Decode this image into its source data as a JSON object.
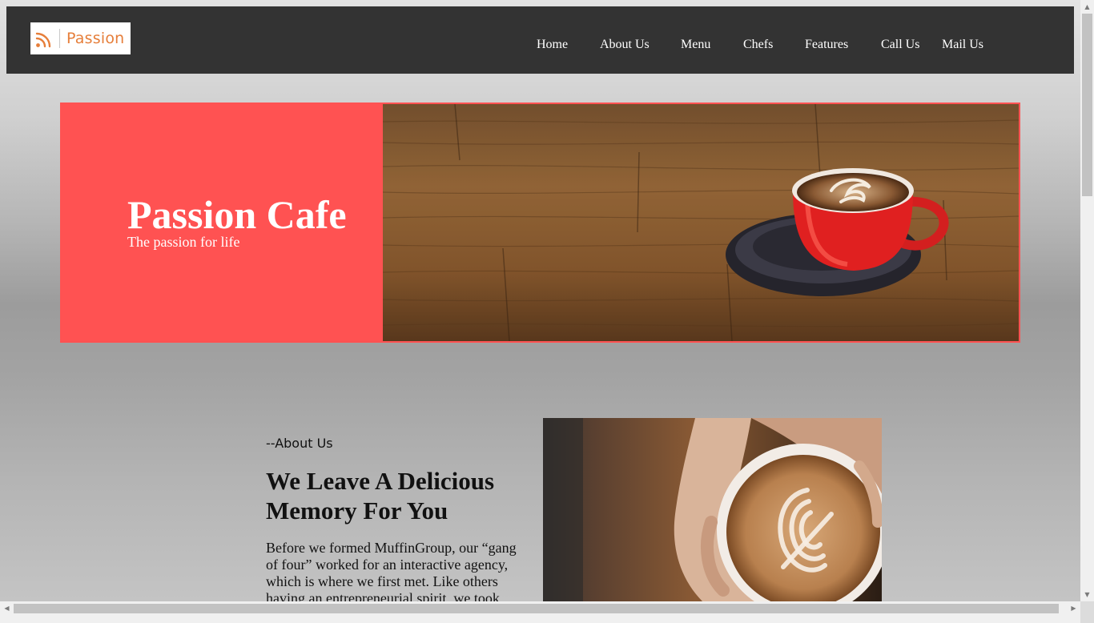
{
  "nav": {
    "logo_text": "Passion",
    "links": [
      "Home",
      "About Us",
      "Menu",
      "Chefs",
      "Features",
      "Call Us",
      "Mail Us"
    ]
  },
  "hero": {
    "title": "Passion Cafe",
    "subtitle": "The passion for life"
  },
  "about": {
    "eyebrow": "--About Us",
    "heading": "We Leave A Delicious Memory For You",
    "body": "Before we formed MuffinGroup, our “gang of four” worked for an interactive agency, which is where we first met. Like others having an entrepreneurial spirit, we took"
  },
  "colors": {
    "navbar": "#333333",
    "accent": "#ff5252",
    "logo_text": "#e67e3a"
  }
}
